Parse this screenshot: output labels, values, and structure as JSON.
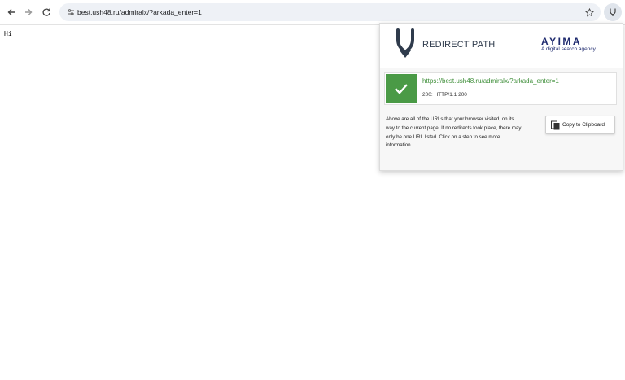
{
  "browser": {
    "url": "best.ush48.ru/admiralx/?arkada_enter=1",
    "icons": {
      "back": "arrow-left-icon",
      "forward": "arrow-right-icon",
      "reload": "reload-icon",
      "site_info": "tune-icon",
      "bookmark": "star-icon",
      "extension": "redirect-path-icon"
    }
  },
  "page": {
    "body_text": "Hi"
  },
  "popup": {
    "brand_name": "REDIRECT PATH",
    "partner_logo": "AYIMA",
    "partner_tagline": "A digital search agency",
    "result": {
      "url": "https://best.ush48.ru/admiralx/?arkada_enter=1",
      "status": "200: HTTP/1.1 200",
      "status_color": "#4a9a46"
    },
    "description": "Above are all of the URLs that your browser visited, on its way to the current page. If no redirects took place, there may only be one URL listed. Click on a step to see more information.",
    "copy_button_label": "Copy to Clipboard"
  },
  "colors": {
    "success_green": "#4a9a46",
    "brand_navy": "#1e2a6e",
    "url_green": "#3f8f3a"
  }
}
